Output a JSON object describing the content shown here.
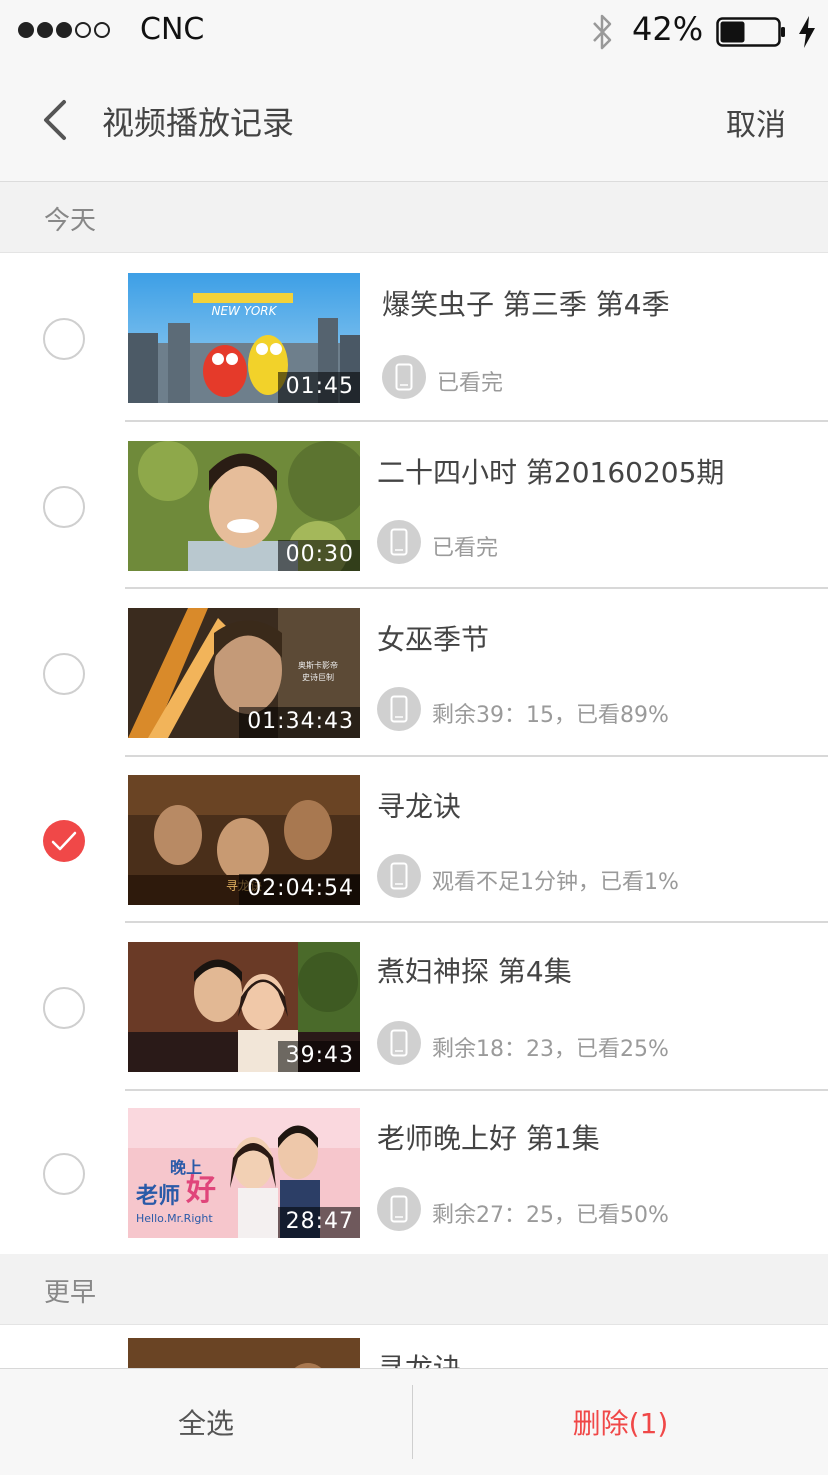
{
  "status_bar": {
    "signal": [
      "full",
      "full",
      "full",
      "empty",
      "empty"
    ],
    "carrier": "CNC",
    "battery_percent": "42%",
    "battery_level": 0.42
  },
  "nav": {
    "title": "视频播放记录",
    "cancel_label": "取消"
  },
  "sections": [
    {
      "label": "今天"
    },
    {
      "label": "更早"
    }
  ],
  "items": [
    {
      "title": "爆笑虫子 第三季 第4季",
      "duration": "01:45",
      "status": "已看完",
      "checked": false
    },
    {
      "title": "二十四小时 第20160205期",
      "duration": "00:30",
      "status": "已看完",
      "checked": false
    },
    {
      "title": "女巫季节",
      "duration": "01:34:43",
      "status": "剩余39：15，已看89%",
      "checked": false
    },
    {
      "title": "寻龙诀",
      "duration": "02:04:54",
      "status": "观看不足1分钟，已看1%",
      "checked": true
    },
    {
      "title": "煮妇神探 第4集",
      "duration": "39:43",
      "status": "剩余18：23，已看25%",
      "checked": false
    },
    {
      "title": "老师晚上好 第1集",
      "duration": "28:47",
      "status": "剩余27：25，已看50%",
      "checked": false
    },
    {
      "title": "寻龙诀"
    }
  ],
  "bottom": {
    "select_all_label": "全选",
    "delete_label": "删除(1)"
  },
  "colors": {
    "accent": "#f04848",
    "background": "#f7f7f7"
  },
  "icons": {
    "back": "chevron-left-icon",
    "device": "phone-icon",
    "check": "checkmark-icon"
  }
}
